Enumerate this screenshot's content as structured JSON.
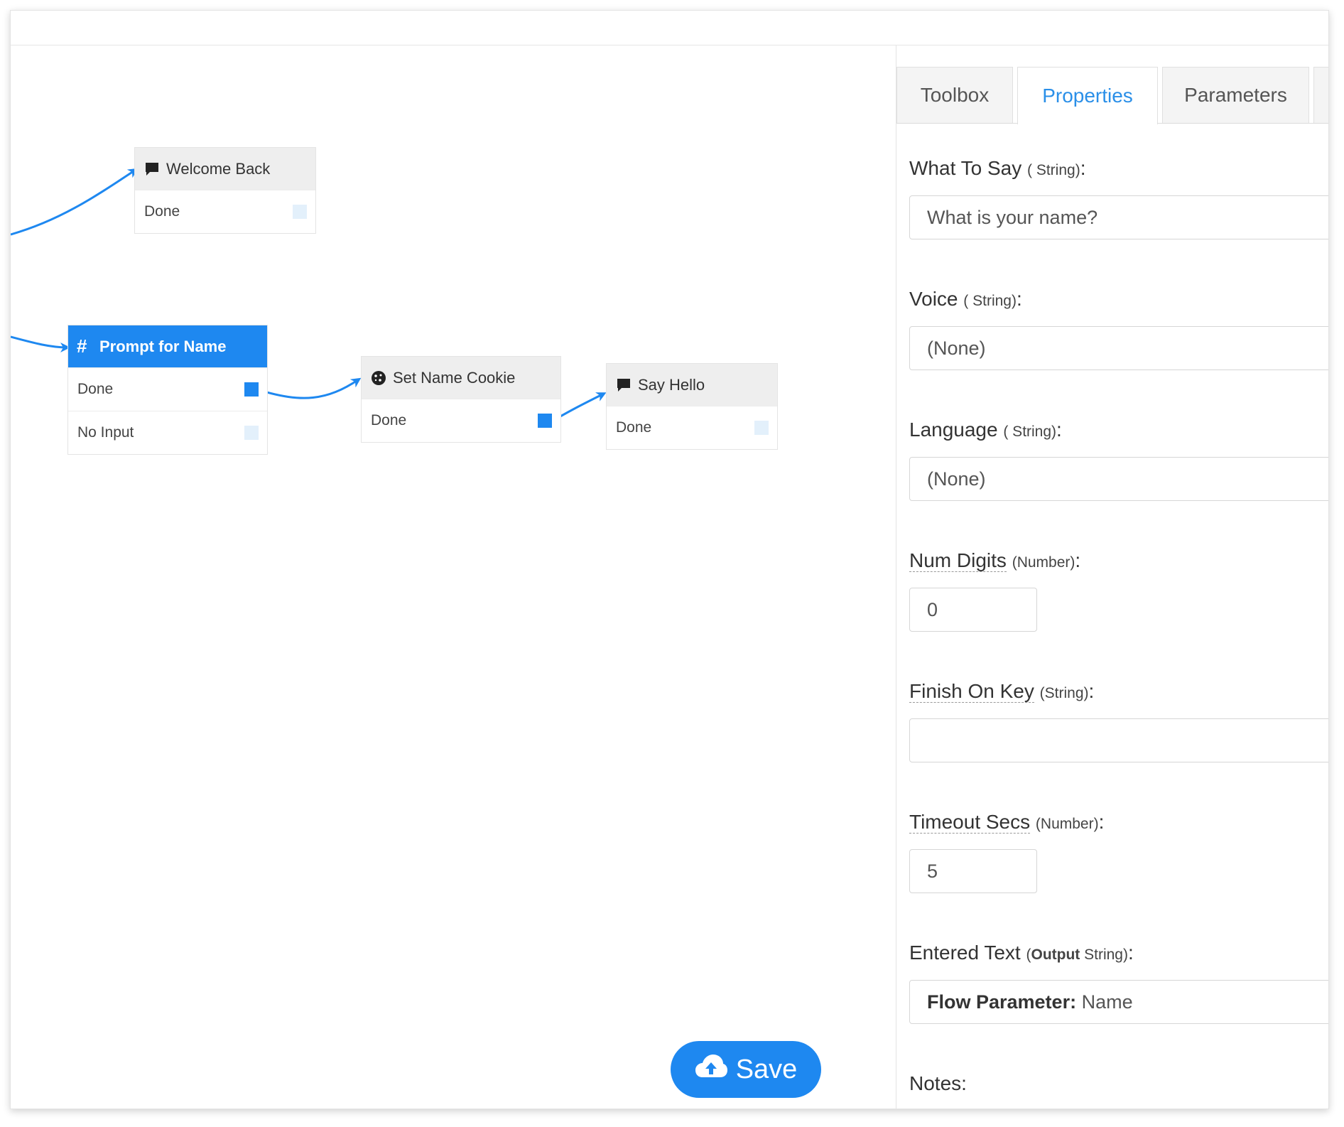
{
  "canvas": {
    "nodes": {
      "welcome_back": {
        "title": "Welcome Back",
        "icon": "speech-bubble-icon",
        "outputs": [
          "Done"
        ]
      },
      "prompt_for_name": {
        "title": "Prompt for Name",
        "icon": "hash-icon",
        "outputs": [
          "Done",
          "No Input"
        ]
      },
      "set_name_cookie": {
        "title": "Set Name Cookie",
        "icon": "cookie-icon",
        "outputs": [
          "Done"
        ]
      },
      "say_hello": {
        "title": "Say Hello",
        "icon": "speech-bubble-icon",
        "outputs": [
          "Done"
        ]
      }
    },
    "save_button": {
      "label": "Save",
      "icon": "cloud-upload-icon"
    }
  },
  "panel": {
    "tabs": [
      "Toolbox",
      "Properties",
      "Parameters"
    ],
    "active_tab": "Properties",
    "fields": {
      "what_to_say": {
        "label": "What To Say",
        "type": "( String)",
        "value": "What is your name?"
      },
      "voice": {
        "label": "Voice",
        "type": "( String)",
        "value": "(None)"
      },
      "language": {
        "label": "Language",
        "type": "( String)",
        "value": "(None)"
      },
      "num_digits": {
        "label": "Num Digits",
        "type": "(Number)",
        "value": "0"
      },
      "finish_on_key": {
        "label": "Finish On Key",
        "type": "(String)",
        "value": ""
      },
      "timeout_secs": {
        "label": "Timeout Secs",
        "type": "(Number)",
        "value": "5"
      },
      "entered_text": {
        "label": "Entered Text",
        "type_prefix": "(",
        "type_bold": "Output",
        "type_suffix": " String)",
        "value_label": "Flow Parameter:",
        "value": "Name"
      },
      "notes": {
        "label": "Notes"
      }
    }
  },
  "colors": {
    "accent": "#1e88f0",
    "tab_active_text": "#2a8fe8",
    "node_header": "#eeeeee"
  }
}
